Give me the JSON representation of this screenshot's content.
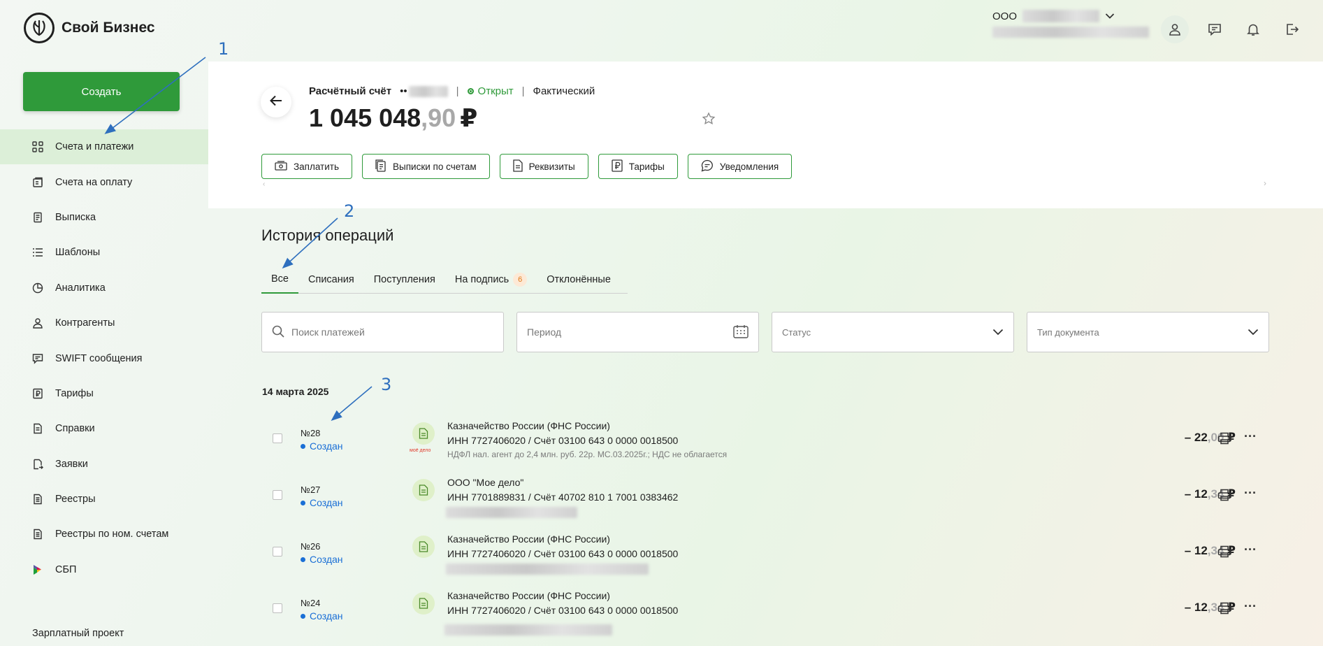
{
  "brand": {
    "name": "Свой Бизнес"
  },
  "sidebar": {
    "create_label": "Создать",
    "items": [
      {
        "label": "Счета и платежи",
        "icon": "grid-icon",
        "active": true
      },
      {
        "label": "Счета на оплату",
        "icon": "invoice-icon"
      },
      {
        "label": "Выписка",
        "icon": "statement-icon"
      },
      {
        "label": "Шаблоны",
        "icon": "list-icon"
      },
      {
        "label": "Аналитика",
        "icon": "pie-chart-icon"
      },
      {
        "label": "Контрагенты",
        "icon": "person-icon"
      },
      {
        "label": "SWIFT сообщения",
        "icon": "message-icon"
      },
      {
        "label": "Тарифы",
        "icon": "ruble-doc-icon"
      },
      {
        "label": "Справки",
        "icon": "document-icon"
      },
      {
        "label": "Заявки",
        "icon": "request-icon"
      },
      {
        "label": "Реестры",
        "icon": "registry-icon"
      },
      {
        "label": "Реестры по ном. счетам",
        "icon": "registry-icon"
      },
      {
        "label": "СБП",
        "icon": "sbp-icon"
      }
    ],
    "footer_label": "Зарплатный проект"
  },
  "header": {
    "org_prefix": "ООО"
  },
  "account": {
    "title": "Расчётный счёт",
    "masked": "••",
    "status": "Открыт",
    "type": "Фактический",
    "balance_main": "1 045 048",
    "balance_cents": ",90",
    "currency": "₽",
    "actions": [
      "Заплатить",
      "Выписки по счетам",
      "Реквизиты",
      "Тарифы",
      "Уведомления"
    ]
  },
  "history": {
    "title": "История операций",
    "tabs": [
      {
        "label": "Все",
        "active": true
      },
      {
        "label": "Списания"
      },
      {
        "label": "Поступления"
      },
      {
        "label": "На подпись",
        "badge": "6"
      },
      {
        "label": "Отклонённые"
      }
    ],
    "filters": {
      "search_placeholder": "Поиск платежей",
      "period_placeholder": "Период",
      "status_placeholder": "Статус",
      "doctype_placeholder": "Тип документа"
    },
    "date_heading": "14 марта 2025",
    "operations": [
      {
        "number": "№28",
        "status": "Создан",
        "counterparty": "Казначейство России (ФНС России)",
        "details": "ИНН 7727406020 / Счёт 03100 643 0 0000 0018500",
        "description": "НДФЛ нал. агент до 2,4 млн. руб. 22р. МС.03.2025г.; НДС не облагается",
        "doc_badge": "моё дело",
        "amount_main": "– 22",
        "amount_cents": ",00",
        "currency": "₽"
      },
      {
        "number": "№27",
        "status": "Создан",
        "counterparty": "ООО \"Мое дело\"",
        "details": "ИНН 7701889831 / Счёт 40702 810 1 7001 0383462",
        "amount_main": "– 12",
        "amount_cents": ",34",
        "currency": "₽"
      },
      {
        "number": "№26",
        "status": "Создан",
        "counterparty": "Казначейство России (ФНС России)",
        "details": "ИНН 7727406020 / Счёт 03100 643 0 0000 0018500",
        "amount_main": "– 12",
        "amount_cents": ",34",
        "currency": "₽"
      },
      {
        "number": "№24",
        "status": "Создан",
        "counterparty": "Казначейство России (ФНС России)",
        "details": "ИНН 7727406020 / Счёт 03100 643 0 0000 0018500",
        "amount_main": "– 12",
        "amount_cents": ",34",
        "currency": "₽"
      }
    ]
  },
  "annotations": [
    "1",
    "2",
    "3"
  ],
  "colors": {
    "accent": "#2f9a3a",
    "link": "#1a6fd6",
    "annotation": "#2e6fbe",
    "badge": "#e07b1a"
  }
}
